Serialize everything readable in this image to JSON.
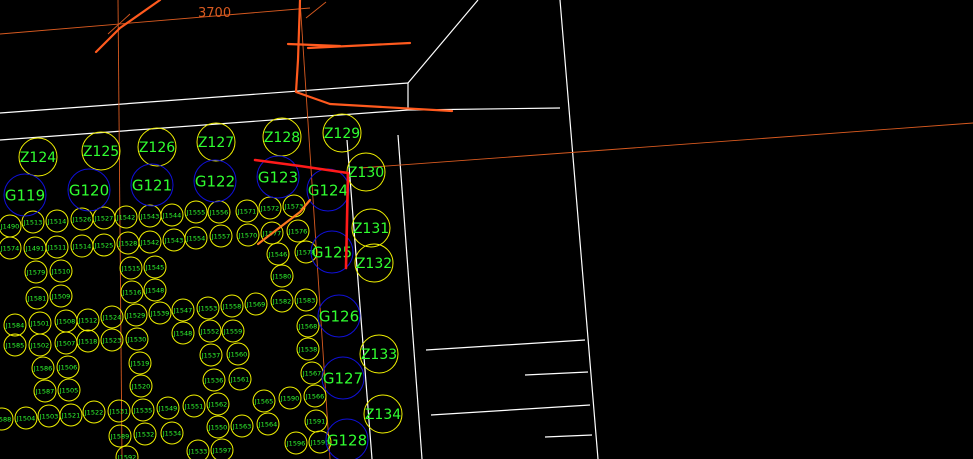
{
  "drawing": {
    "dimension_label": "3700",
    "colors": {
      "background": "#000000",
      "wall_line": "#ffffff",
      "pile_yellow": "#f0f000",
      "pile_blue": "#1010d8",
      "label_green": "#30ff30",
      "markup_orange": "#ff5a1e",
      "markup_red": "#ff1a1a",
      "dimension_line": "#d85a20"
    },
    "z_piles": [
      {
        "label": "Z124"
      },
      {
        "label": "Z125"
      },
      {
        "label": "Z126"
      },
      {
        "label": "Z127"
      },
      {
        "label": "Z128"
      },
      {
        "label": "Z129"
      },
      {
        "label": "Z130"
      },
      {
        "label": "Z131"
      },
      {
        "label": "Z132"
      },
      {
        "label": "Z133"
      },
      {
        "label": "Z134"
      }
    ],
    "g_piles": [
      {
        "label": "G119"
      },
      {
        "label": "G120"
      },
      {
        "label": "G121"
      },
      {
        "label": "G122"
      },
      {
        "label": "G123"
      },
      {
        "label": "G124"
      },
      {
        "label": "G125"
      },
      {
        "label": "G126"
      },
      {
        "label": "G127"
      },
      {
        "label": "G128"
      }
    ],
    "j_piles": [
      {
        "label": "J1490"
      },
      {
        "label": "J1513"
      },
      {
        "label": "J1514"
      },
      {
        "label": "J1526"
      },
      {
        "label": "J1527"
      },
      {
        "label": "J1542"
      },
      {
        "label": "J1543"
      },
      {
        "label": "J1544"
      },
      {
        "label": "J1555"
      },
      {
        "label": "J1556"
      },
      {
        "label": "J1571"
      },
      {
        "label": "J1572"
      },
      {
        "label": "J1573"
      },
      {
        "label": "J1574"
      },
      {
        "label": "J1491"
      },
      {
        "label": "J1511"
      },
      {
        "label": "J1514"
      },
      {
        "label": "J1525"
      },
      {
        "label": "J1528"
      },
      {
        "label": "J1542"
      },
      {
        "label": "J1543"
      },
      {
        "label": "J1554"
      },
      {
        "label": "J1557"
      },
      {
        "label": "J1570"
      },
      {
        "label": "J1577"
      },
      {
        "label": "J1576"
      },
      {
        "label": "J1579"
      },
      {
        "label": "J1510"
      },
      {
        "label": "J1515"
      },
      {
        "label": "J1545"
      },
      {
        "label": "J1546"
      },
      {
        "label": "J1578"
      },
      {
        "label": "J1580"
      },
      {
        "label": "J1581"
      },
      {
        "label": "J1509"
      },
      {
        "label": "J1516"
      },
      {
        "label": "J1548"
      },
      {
        "label": "J1547"
      },
      {
        "label": "J1553"
      },
      {
        "label": "J1558"
      },
      {
        "label": "J1569"
      },
      {
        "label": "J1582"
      },
      {
        "label": "J1583"
      },
      {
        "label": "J1584"
      },
      {
        "label": "J1501"
      },
      {
        "label": "J1508"
      },
      {
        "label": "J1512"
      },
      {
        "label": "J1524"
      },
      {
        "label": "J1529"
      },
      {
        "label": "J1539"
      },
      {
        "label": "J1548"
      },
      {
        "label": "J1552"
      },
      {
        "label": "J1559"
      },
      {
        "label": "J1568"
      },
      {
        "label": "J1585"
      },
      {
        "label": "J1502"
      },
      {
        "label": "J1507"
      },
      {
        "label": "J1518"
      },
      {
        "label": "J1523"
      },
      {
        "label": "J1530"
      },
      {
        "label": "J1538"
      },
      {
        "label": "J1586"
      },
      {
        "label": "J1506"
      },
      {
        "label": "J1519"
      },
      {
        "label": "J1537"
      },
      {
        "label": "J1560"
      },
      {
        "label": "J1567"
      },
      {
        "label": "J1587"
      },
      {
        "label": "J1505"
      },
      {
        "label": "J1520"
      },
      {
        "label": "J1536"
      },
      {
        "label": "J1561"
      },
      {
        "label": "J1566"
      },
      {
        "label": "J1588"
      },
      {
        "label": "J1504"
      },
      {
        "label": "J1503"
      },
      {
        "label": "J1521"
      },
      {
        "label": "J1522"
      },
      {
        "label": "J1531"
      },
      {
        "label": "J1535"
      },
      {
        "label": "J1549"
      },
      {
        "label": "J1551"
      },
      {
        "label": "J1562"
      },
      {
        "label": "J1565"
      },
      {
        "label": "J1590"
      },
      {
        "label": "J1589"
      },
      {
        "label": "J1532"
      },
      {
        "label": "J1534"
      },
      {
        "label": "J1550"
      },
      {
        "label": "J1563"
      },
      {
        "label": "J1564"
      },
      {
        "label": "J1591"
      },
      {
        "label": "J1592"
      },
      {
        "label": "J1533"
      },
      {
        "label": "J1597"
      },
      {
        "label": "J1596"
      },
      {
        "label": "J1595"
      },
      {
        "label": "J1594"
      }
    ]
  }
}
